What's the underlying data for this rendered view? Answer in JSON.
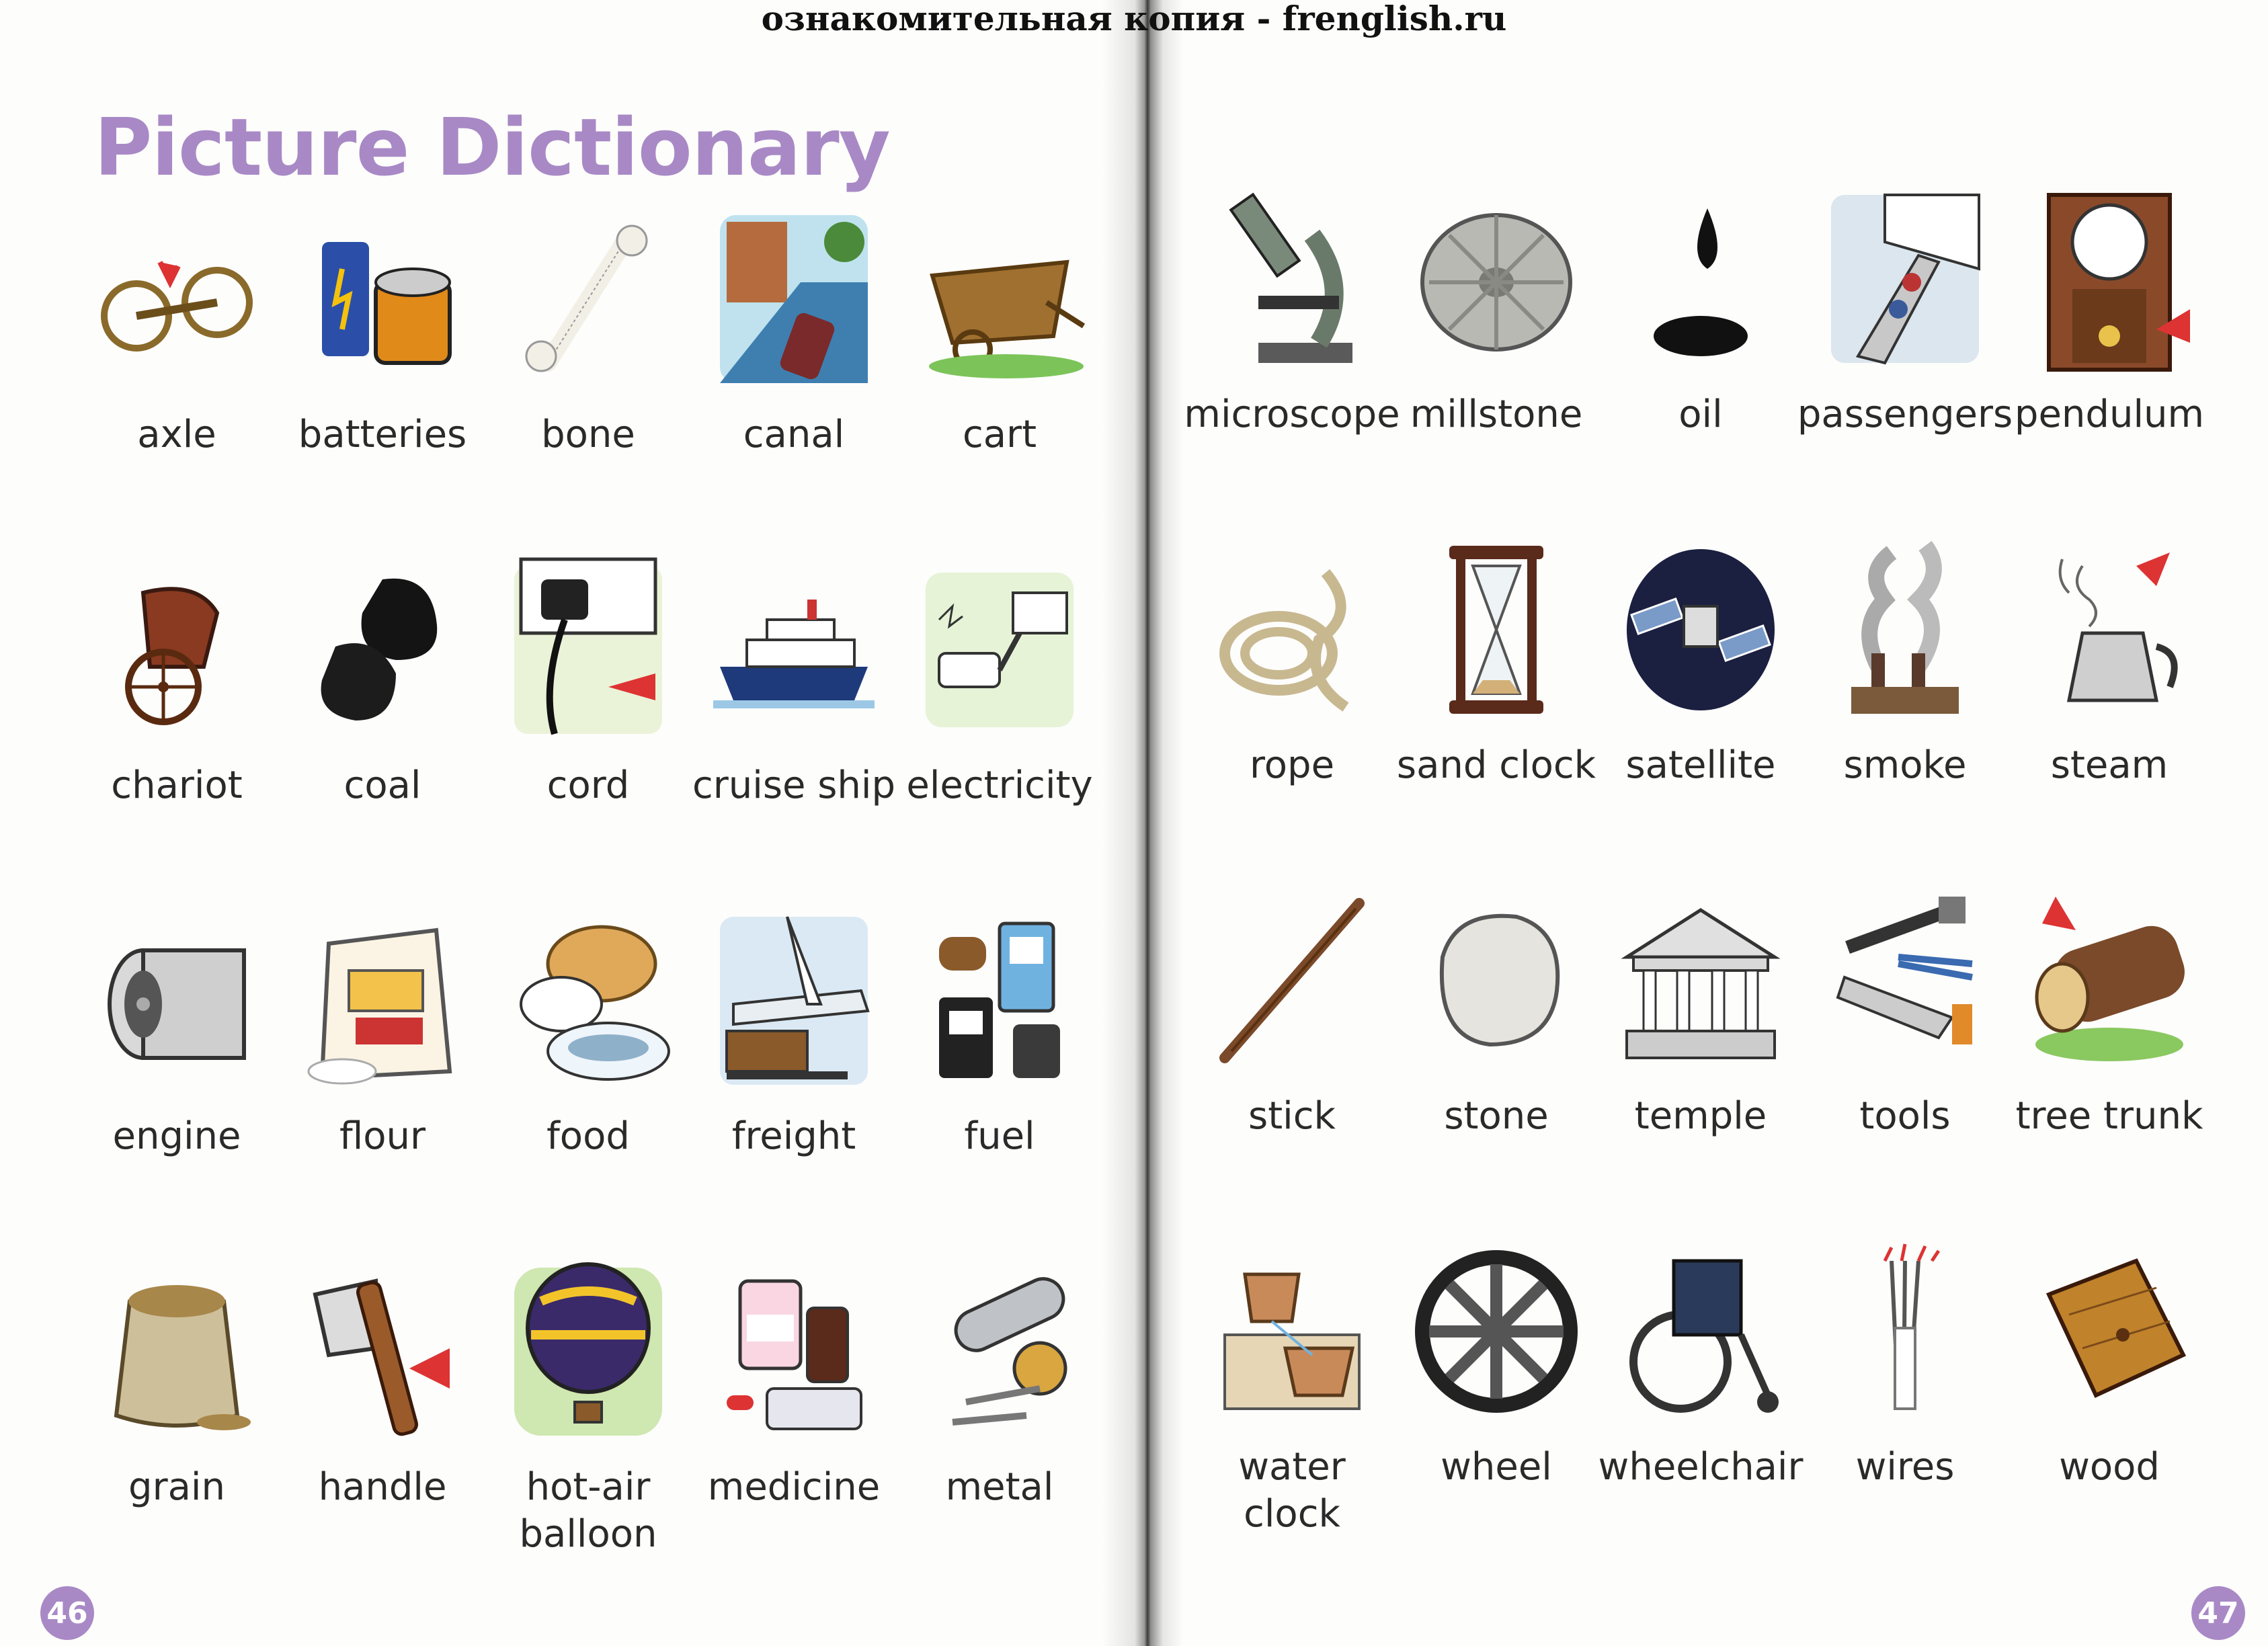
{
  "watermark": "ознакомительная копия - frenglish.ru",
  "title": "Picture Dictionary",
  "pages": {
    "left_number": "46",
    "right_number": "47"
  },
  "left_entries": [
    {
      "word": "axle",
      "icon": "axle-icon"
    },
    {
      "word": "batteries",
      "icon": "batteries-icon"
    },
    {
      "word": "bone",
      "icon": "bone-icon"
    },
    {
      "word": "canal",
      "icon": "canal-icon"
    },
    {
      "word": "cart",
      "icon": "cart-icon"
    },
    {
      "word": "chariot",
      "icon": "chariot-icon"
    },
    {
      "word": "coal",
      "icon": "coal-icon"
    },
    {
      "word": "cord",
      "icon": "cord-icon"
    },
    {
      "word": "cruise ship",
      "icon": "cruise-ship-icon"
    },
    {
      "word": "electricity",
      "icon": "electricity-icon"
    },
    {
      "word": "engine",
      "icon": "engine-icon"
    },
    {
      "word": "flour",
      "icon": "flour-icon"
    },
    {
      "word": "food",
      "icon": "food-icon"
    },
    {
      "word": "freight",
      "icon": "freight-icon"
    },
    {
      "word": "fuel",
      "icon": "fuel-icon"
    },
    {
      "word": "grain",
      "icon": "grain-icon"
    },
    {
      "word": "handle",
      "icon": "handle-icon"
    },
    {
      "word": "hot-air\nballoon",
      "icon": "hot-air-balloon-icon"
    },
    {
      "word": "medicine",
      "icon": "medicine-icon"
    },
    {
      "word": "metal",
      "icon": "metal-icon"
    }
  ],
  "right_entries": [
    {
      "word": "microscope",
      "icon": "microscope-icon"
    },
    {
      "word": "millstone",
      "icon": "millstone-icon"
    },
    {
      "word": "oil",
      "icon": "oil-icon"
    },
    {
      "word": "passengers",
      "icon": "passengers-icon"
    },
    {
      "word": "pendulum",
      "icon": "pendulum-icon"
    },
    {
      "word": "rope",
      "icon": "rope-icon"
    },
    {
      "word": "sand clock",
      "icon": "sand-clock-icon"
    },
    {
      "word": "satellite",
      "icon": "satellite-icon"
    },
    {
      "word": "smoke",
      "icon": "smoke-icon"
    },
    {
      "word": "steam",
      "icon": "steam-icon"
    },
    {
      "word": "stick",
      "icon": "stick-icon"
    },
    {
      "word": "stone",
      "icon": "stone-icon"
    },
    {
      "word": "temple",
      "icon": "temple-icon"
    },
    {
      "word": "tools",
      "icon": "tools-icon"
    },
    {
      "word": "tree trunk",
      "icon": "tree-trunk-icon"
    },
    {
      "word": "water clock",
      "icon": "water-clock-icon"
    },
    {
      "word": "wheel",
      "icon": "wheel-icon"
    },
    {
      "word": "wheelchair",
      "icon": "wheelchair-icon"
    },
    {
      "word": "wires",
      "icon": "wires-icon"
    },
    {
      "word": "wood",
      "icon": "wood-icon"
    }
  ],
  "colors": {
    "title": "#a889c5",
    "page_badge": "#a889c5",
    "text": "#2a2a2a"
  }
}
